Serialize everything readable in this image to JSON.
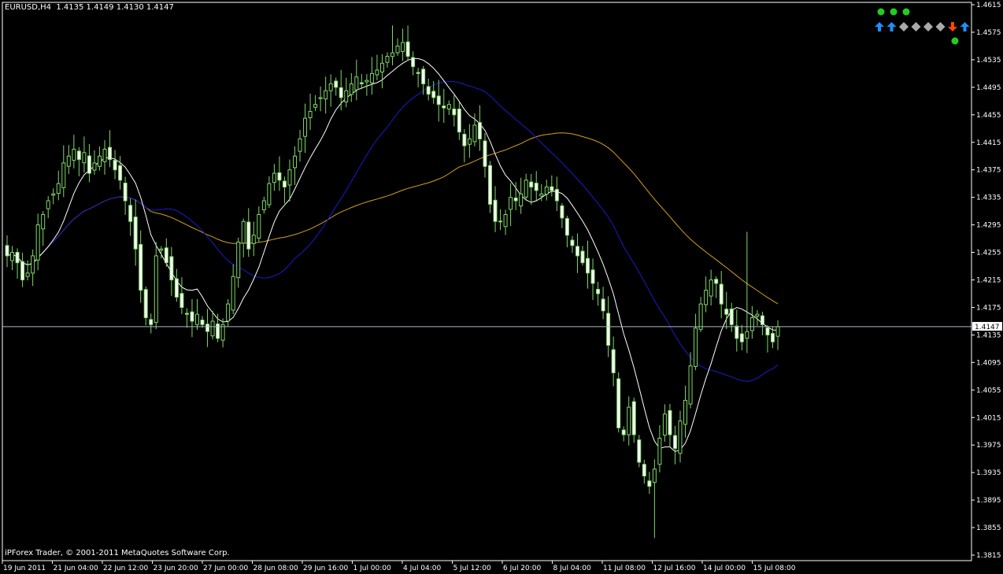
{
  "header": {
    "symbol_timeframe": "EURUSD,H4",
    "ohlc": "1.4135 1.4149 1.4130 1.4147"
  },
  "footer": {
    "copyright": "iPForex Trader, © 2001-2011 MetaQuotes Software Corp."
  },
  "current_price_label": "1.4147",
  "indicator_panel": {
    "row1": [
      "green-dot",
      "green-dot",
      "green-dot"
    ],
    "row2": [
      "up-arrow-blue",
      "up-arrow-blue",
      "diamond-gray",
      "diamond-gray",
      "diamond-gray",
      "diamond-gray",
      "down-arrow-red",
      "up-arrow-blue"
    ],
    "row3": [
      "green-dot"
    ],
    "colors": {
      "green": "#22cc22",
      "blue": "#1e90ff",
      "gray": "#aaaaaa",
      "red": "#ff4500"
    }
  },
  "colors": {
    "background": "#000000",
    "candle": "#7fd866",
    "candle_body_up": "#000000",
    "candle_body_down": "#ffffff",
    "grid": "#ffffff",
    "ma_fast": "#ffffff",
    "ma_mid": "#1a1acc",
    "ma_slow": "#d4a017",
    "price_line": "#a9b8c8"
  },
  "chart_data": {
    "type": "candlestick",
    "symbol": "EURUSD",
    "timeframe": "H4",
    "ylim": [
      1.3815,
      1.4615
    ],
    "y_ticks": [
      "1.4615",
      "1.4575",
      "1.4535",
      "1.4495",
      "1.4455",
      "1.4415",
      "1.4375",
      "1.4335",
      "1.4295",
      "1.4255",
      "1.4215",
      "1.4175",
      "1.4135",
      "1.4095",
      "1.4055",
      "1.4015",
      "1.3975",
      "1.3935",
      "1.3895",
      "1.3855",
      "1.3815"
    ],
    "x_ticks": [
      "19 Jun 2011",
      "21 Jun 04:00",
      "22 Jun 12:00",
      "23 Jun 20:00",
      "27 Jun 00:00",
      "28 Jun 08:00",
      "29 Jun 16:00",
      "1 Jul 00:00",
      "4 Jul 04:00",
      "5 Jul 12:00",
      "6 Jul 20:00",
      "8 Jul 04:00",
      "11 Jul 08:00",
      "12 Jul 16:00",
      "14 Jul 00:00",
      "15 Jul 08:00"
    ],
    "current_price": 1.4147,
    "closes": [
      1.425,
      1.4255,
      1.424,
      1.4215,
      1.4225,
      1.425,
      1.4295,
      1.431,
      1.433,
      1.434,
      1.4355,
      1.4385,
      1.4395,
      1.4405,
      1.439,
      1.44,
      1.437,
      1.4385,
      1.4395,
      1.4405,
      1.439,
      1.4375,
      1.436,
      1.433,
      1.43,
      1.426,
      1.42,
      1.416,
      1.415,
      1.425,
      1.426,
      1.424,
      1.4215,
      1.419,
      1.4175,
      1.4165,
      1.4155,
      1.4165,
      1.415,
      1.414,
      1.4155,
      1.413,
      1.415,
      1.418,
      1.422,
      1.427,
      1.43,
      1.426,
      1.428,
      1.431,
      1.433,
      1.4355,
      1.437,
      1.436,
      1.435,
      1.4375,
      1.4395,
      1.442,
      1.445,
      1.446,
      1.447,
      1.448,
      1.449,
      1.45,
      1.4495,
      1.448,
      1.449,
      1.45,
      1.451,
      1.45,
      1.4505,
      1.4515,
      1.452,
      1.453,
      1.454,
      1.4545,
      1.4555,
      1.456,
      1.454,
      1.4525,
      1.4515,
      1.45,
      1.4485,
      1.448,
      1.447,
      1.4465,
      1.447,
      1.4455,
      1.443,
      1.441,
      1.442,
      1.444,
      1.442,
      1.438,
      1.4325,
      1.43,
      1.43,
      1.431,
      1.4335,
      1.433,
      1.434,
      1.436,
      1.435,
      1.4345,
      1.434,
      1.435,
      1.4345,
      1.433,
      1.4305,
      1.428,
      1.4265,
      1.425,
      1.424,
      1.4225,
      1.421,
      1.4195,
      1.417,
      1.412,
      1.408,
      1.4,
      1.399,
      1.403,
      1.399,
      1.395,
      1.393,
      1.3915,
      1.394,
      1.3985,
      1.402,
      1.399,
      1.397,
      1.401,
      1.404,
      1.409,
      1.4145,
      1.418,
      1.42,
      1.4215,
      1.421,
      1.418,
      1.4165,
      1.415,
      1.413,
      1.4125,
      1.414,
      1.416,
      1.4165,
      1.415,
      1.4135,
      1.4125,
      1.4147
    ]
  }
}
